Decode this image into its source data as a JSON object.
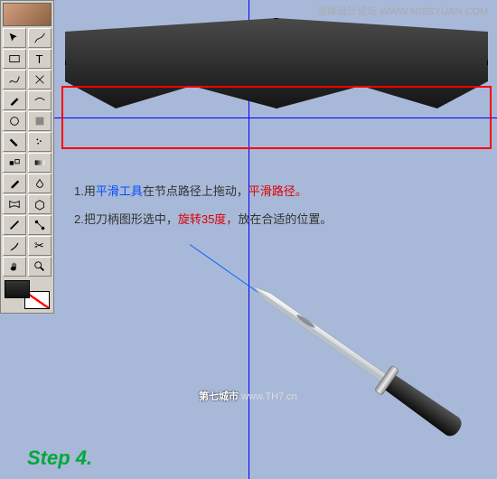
{
  "watermark_tr": "思缘设计论坛 WWW.MISSYUAN.COM",
  "watermark_mid_bold": "第七城市",
  "watermark_mid_url": "www.TH7.cn",
  "step_label": "Step 4.",
  "instructions": {
    "line1_prefix": "1.用",
    "line1_tool": "平滑工具",
    "line1_mid": "在节点路径上拖动，",
    "line1_em": "平滑路径。",
    "line2_prefix": "2.把刀柄图形选中，",
    "line2_em": "旋转35度，",
    "line2_suffix": "放在合适的位置。"
  },
  "tools": {
    "row1a": "pointer",
    "row1b": "freehand",
    "row2a": "rect",
    "row2b": "text",
    "row3a": "bezier",
    "row3b": "edit",
    "row4a": "pencil",
    "row4b": "smooth",
    "row5a": "spiral",
    "row5b": "color",
    "row6a": "paint",
    "row6b": "spray",
    "row7a": "blend",
    "row7b": "gradient",
    "row8a": "dropper",
    "row8b": "transparency",
    "row9a": "envelope",
    "row9b": "extrude",
    "row10a": "outline",
    "row10b": "connector",
    "row11a": "knife",
    "row11b": "scissors",
    "row12a": "hand",
    "row12b": "zoom"
  }
}
